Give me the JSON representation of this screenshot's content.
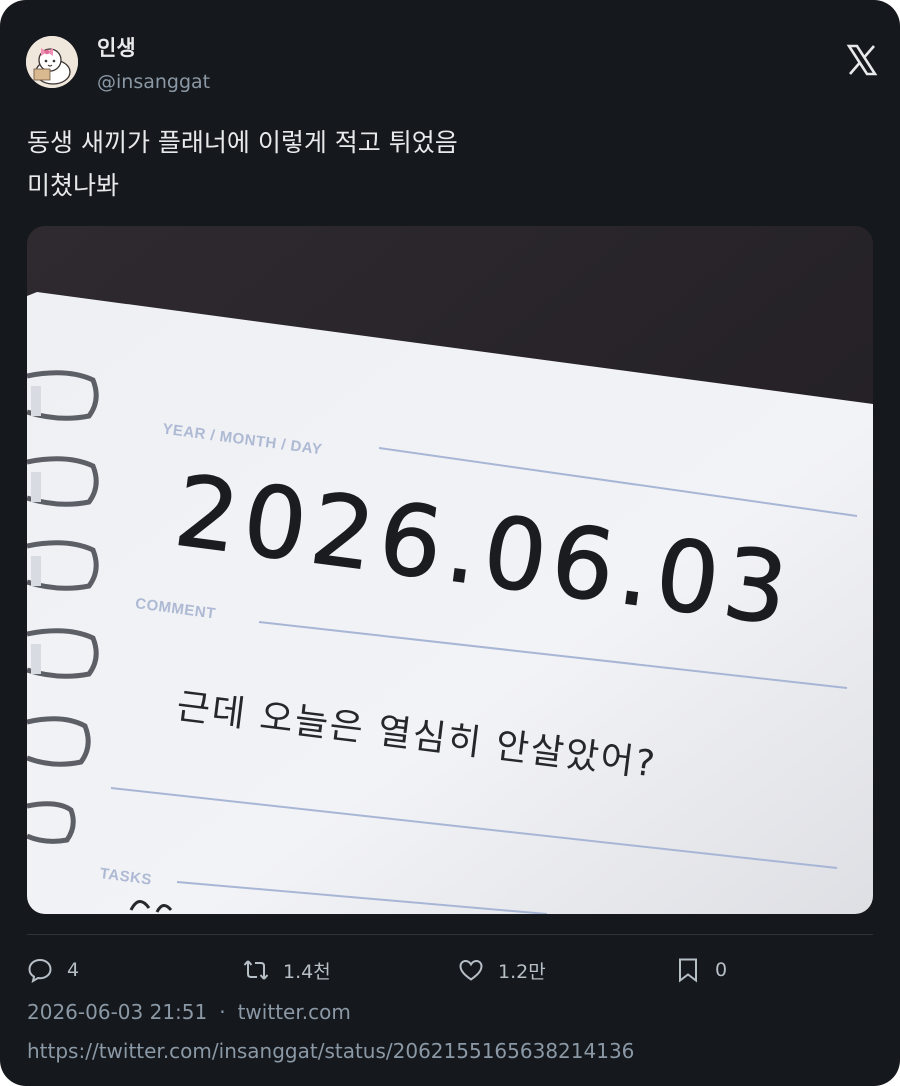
{
  "author": {
    "display_name": "인생",
    "handle": "@insanggat"
  },
  "tweet": {
    "lines": [
      "동생 새끼가 플래너에 이렇게 적고 튀었음",
      "미쳤나봐"
    ]
  },
  "photo": {
    "planner": {
      "header_label": "YEAR / MONTH / DAY",
      "date": "2026.06.03",
      "comment_label": "COMMENT",
      "comment_text": "근데 오늘은 열심히 안살았어?",
      "tasks_label": "TASKS"
    }
  },
  "actions": {
    "reply_count": "4",
    "retweet_count": "1.4천",
    "like_count": "1.2만",
    "bookmark_count": "0"
  },
  "meta": {
    "timestamp": "2026-06-03 21:51",
    "separator": "·",
    "source": "twitter.com",
    "url": "https://twitter.com/insanggat/status/2062155165638214136"
  },
  "colors": {
    "card_background": "#15181c",
    "primary_text": "#e7e9ea",
    "secondary_text": "#8b98a5",
    "divider": "#2f3336"
  },
  "icons": [
    "x-logo-icon",
    "reply-icon",
    "retweet-icon",
    "like-icon",
    "bookmark-icon"
  ]
}
